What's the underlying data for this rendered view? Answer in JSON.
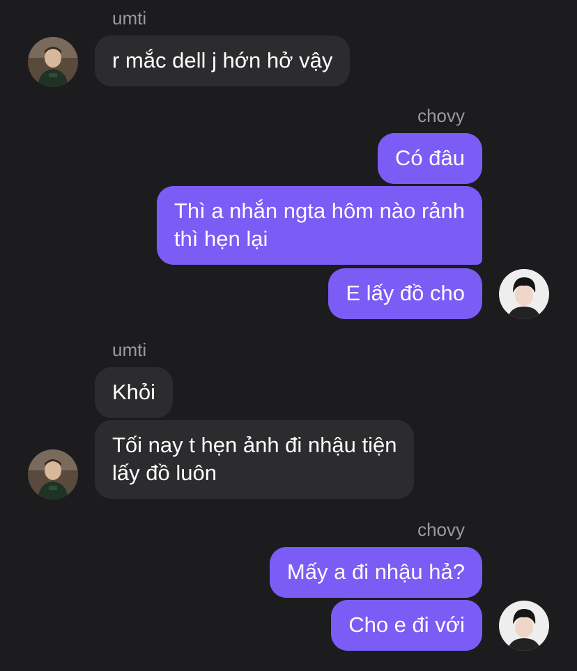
{
  "contacts": {
    "other": {
      "name": "umti",
      "avatar_icon": "person-photo-icon"
    },
    "me": {
      "name": "chovy",
      "avatar_icon": "person-photo-icon"
    }
  },
  "groups": [
    {
      "sender": "umti",
      "messages": [
        "r mắc dell j hớn hở vậy"
      ]
    },
    {
      "sender": "chovy",
      "messages": [
        "Có đâu",
        "Thì a nhắn ngta hôm nào rảnh\nthì hẹn lại",
        "E lấy đồ cho"
      ]
    },
    {
      "sender": "umti",
      "messages": [
        "Khỏi",
        "Tối nay t hẹn ảnh đi nhậu tiện\nlấy đồ luôn"
      ]
    },
    {
      "sender": "chovy",
      "messages": [
        "Mấy a đi nhậu hả?",
        "Cho e đi với"
      ]
    }
  ],
  "colors": {
    "background": "#1c1c1e",
    "incoming_bubble": "#2c2c2e",
    "outgoing_bubble": "#7b5cf5",
    "sender_name": "#9a9a9f",
    "text": "#ffffff"
  }
}
